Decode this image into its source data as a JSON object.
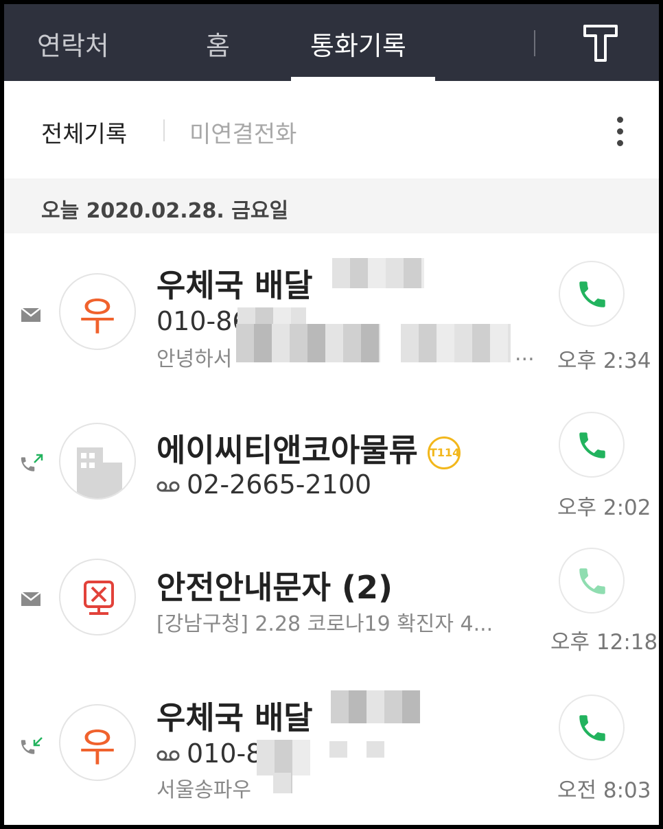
{
  "top_tabs": [
    {
      "label": "연락처",
      "active": false
    },
    {
      "label": "홈",
      "active": false
    },
    {
      "label": "통화기록",
      "active": true
    }
  ],
  "logo": "T",
  "sub_tabs": [
    {
      "label": "전체기록",
      "active": true
    },
    {
      "label": "미연결전화",
      "active": false
    }
  ],
  "date_header": "오늘 2020.02.28. 금요일",
  "calls": [
    {
      "type_icon": "message-icon",
      "avatar_letter": "우",
      "name": "우체국 배달",
      "number": "010-86",
      "preview": "안녕하서",
      "preview_suffix": "...",
      "time": "오후 2:34"
    },
    {
      "type_icon": "outgoing-call-icon",
      "avatar_icon": "building-icon",
      "name": "에이씨티앤코아물류",
      "badge": "T114",
      "number": "02-2665-2100",
      "time": "오후 2:02"
    },
    {
      "type_icon": "message-icon",
      "avatar_icon": "disaster-alert-icon",
      "name": "안전안내문자 (2)",
      "preview": "[강남구청] 2.28 코로나19 확진자 4...",
      "time": "오후 12:18"
    },
    {
      "type_icon": "incoming-call-icon",
      "avatar_letter": "우",
      "name": "우체국 배달",
      "number": "010-8",
      "preview": "서울송파우",
      "time": "오전 8:03"
    }
  ],
  "colors": {
    "topbar": "#2e313d",
    "call_green": "#22b35e",
    "post_orange": "#f0622d",
    "t114_yellow": "#f2b71c"
  }
}
